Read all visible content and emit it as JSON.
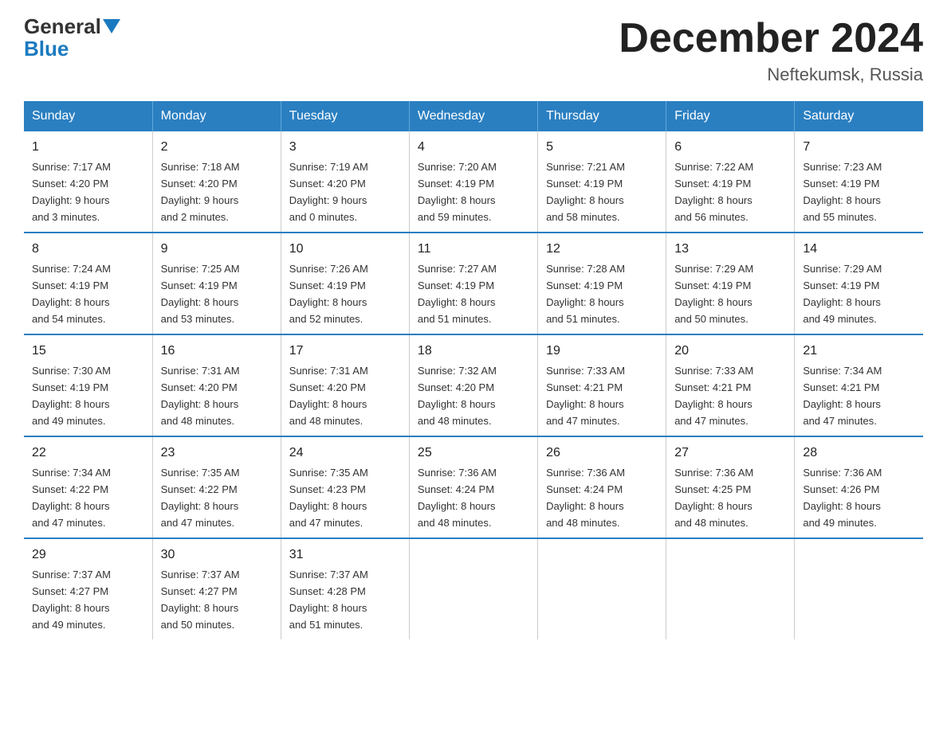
{
  "logo": {
    "part1": "General",
    "part2": "Blue"
  },
  "title": "December 2024",
  "subtitle": "Neftekumsk, Russia",
  "headers": [
    "Sunday",
    "Monday",
    "Tuesday",
    "Wednesday",
    "Thursday",
    "Friday",
    "Saturday"
  ],
  "weeks": [
    [
      {
        "day": "1",
        "sunrise": "7:17 AM",
        "sunset": "4:20 PM",
        "daylight": "9 hours and 3 minutes."
      },
      {
        "day": "2",
        "sunrise": "7:18 AM",
        "sunset": "4:20 PM",
        "daylight": "9 hours and 2 minutes."
      },
      {
        "day": "3",
        "sunrise": "7:19 AM",
        "sunset": "4:20 PM",
        "daylight": "9 hours and 0 minutes."
      },
      {
        "day": "4",
        "sunrise": "7:20 AM",
        "sunset": "4:19 PM",
        "daylight": "8 hours and 59 minutes."
      },
      {
        "day": "5",
        "sunrise": "7:21 AM",
        "sunset": "4:19 PM",
        "daylight": "8 hours and 58 minutes."
      },
      {
        "day": "6",
        "sunrise": "7:22 AM",
        "sunset": "4:19 PM",
        "daylight": "8 hours and 56 minutes."
      },
      {
        "day": "7",
        "sunrise": "7:23 AM",
        "sunset": "4:19 PM",
        "daylight": "8 hours and 55 minutes."
      }
    ],
    [
      {
        "day": "8",
        "sunrise": "7:24 AM",
        "sunset": "4:19 PM",
        "daylight": "8 hours and 54 minutes."
      },
      {
        "day": "9",
        "sunrise": "7:25 AM",
        "sunset": "4:19 PM",
        "daylight": "8 hours and 53 minutes."
      },
      {
        "day": "10",
        "sunrise": "7:26 AM",
        "sunset": "4:19 PM",
        "daylight": "8 hours and 52 minutes."
      },
      {
        "day": "11",
        "sunrise": "7:27 AM",
        "sunset": "4:19 PM",
        "daylight": "8 hours and 51 minutes."
      },
      {
        "day": "12",
        "sunrise": "7:28 AM",
        "sunset": "4:19 PM",
        "daylight": "8 hours and 51 minutes."
      },
      {
        "day": "13",
        "sunrise": "7:29 AM",
        "sunset": "4:19 PM",
        "daylight": "8 hours and 50 minutes."
      },
      {
        "day": "14",
        "sunrise": "7:29 AM",
        "sunset": "4:19 PM",
        "daylight": "8 hours and 49 minutes."
      }
    ],
    [
      {
        "day": "15",
        "sunrise": "7:30 AM",
        "sunset": "4:19 PM",
        "daylight": "8 hours and 49 minutes."
      },
      {
        "day": "16",
        "sunrise": "7:31 AM",
        "sunset": "4:20 PM",
        "daylight": "8 hours and 48 minutes."
      },
      {
        "day": "17",
        "sunrise": "7:31 AM",
        "sunset": "4:20 PM",
        "daylight": "8 hours and 48 minutes."
      },
      {
        "day": "18",
        "sunrise": "7:32 AM",
        "sunset": "4:20 PM",
        "daylight": "8 hours and 48 minutes."
      },
      {
        "day": "19",
        "sunrise": "7:33 AM",
        "sunset": "4:21 PM",
        "daylight": "8 hours and 47 minutes."
      },
      {
        "day": "20",
        "sunrise": "7:33 AM",
        "sunset": "4:21 PM",
        "daylight": "8 hours and 47 minutes."
      },
      {
        "day": "21",
        "sunrise": "7:34 AM",
        "sunset": "4:21 PM",
        "daylight": "8 hours and 47 minutes."
      }
    ],
    [
      {
        "day": "22",
        "sunrise": "7:34 AM",
        "sunset": "4:22 PM",
        "daylight": "8 hours and 47 minutes."
      },
      {
        "day": "23",
        "sunrise": "7:35 AM",
        "sunset": "4:22 PM",
        "daylight": "8 hours and 47 minutes."
      },
      {
        "day": "24",
        "sunrise": "7:35 AM",
        "sunset": "4:23 PM",
        "daylight": "8 hours and 47 minutes."
      },
      {
        "day": "25",
        "sunrise": "7:36 AM",
        "sunset": "4:24 PM",
        "daylight": "8 hours and 48 minutes."
      },
      {
        "day": "26",
        "sunrise": "7:36 AM",
        "sunset": "4:24 PM",
        "daylight": "8 hours and 48 minutes."
      },
      {
        "day": "27",
        "sunrise": "7:36 AM",
        "sunset": "4:25 PM",
        "daylight": "8 hours and 48 minutes."
      },
      {
        "day": "28",
        "sunrise": "7:36 AM",
        "sunset": "4:26 PM",
        "daylight": "8 hours and 49 minutes."
      }
    ],
    [
      {
        "day": "29",
        "sunrise": "7:37 AM",
        "sunset": "4:27 PM",
        "daylight": "8 hours and 49 minutes."
      },
      {
        "day": "30",
        "sunrise": "7:37 AM",
        "sunset": "4:27 PM",
        "daylight": "8 hours and 50 minutes."
      },
      {
        "day": "31",
        "sunrise": "7:37 AM",
        "sunset": "4:28 PM",
        "daylight": "8 hours and 51 minutes."
      },
      null,
      null,
      null,
      null
    ]
  ]
}
